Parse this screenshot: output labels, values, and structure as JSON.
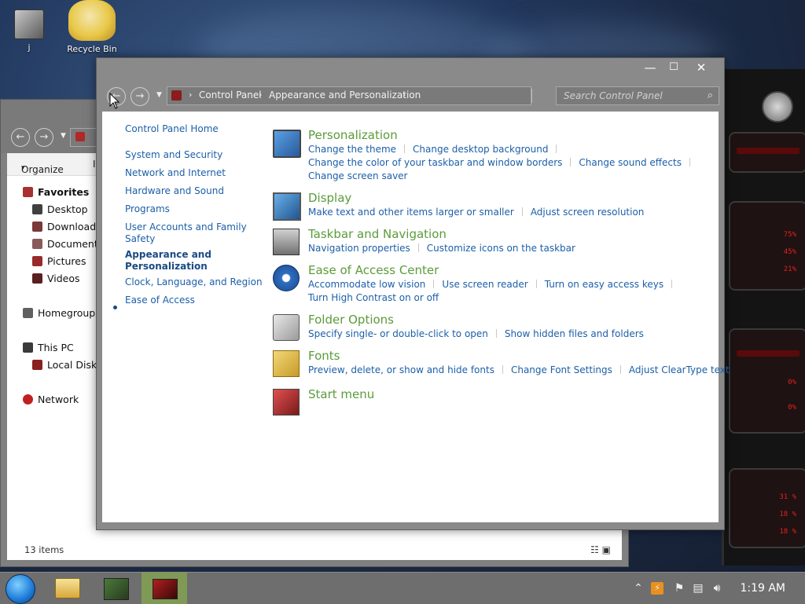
{
  "desktop": {
    "icons": [
      {
        "label": "j"
      },
      {
        "label": "Recycle Bin"
      }
    ]
  },
  "explorer": {
    "toolbar": {
      "organize": "Organize",
      "organize_caret": "▾",
      "cut_label": "I"
    },
    "tree": {
      "favorites": "Favorites",
      "desktop": "Desktop",
      "downloads": "Downloads",
      "documents": "Documents",
      "pictures": "Pictures",
      "videos": "Videos",
      "homegroup": "Homegroup",
      "this_pc": "This PC",
      "local_disk": "Local Disk",
      "network": "Network"
    },
    "status": "13 items"
  },
  "cp": {
    "window_controls": {
      "minimize": "—",
      "maximize": "☐",
      "close": "✕"
    },
    "breadcrumb": {
      "item1": "Control Panel",
      "item2": "Appearance and Personalization",
      "sep": "›"
    },
    "search_placeholder": "Search Control Panel",
    "left_nav": {
      "home": "Control Panel Home",
      "system": "System and Security",
      "network": "Network and Internet",
      "hardware": "Hardware and Sound",
      "programs": "Programs",
      "accounts_1": "User Accounts and Family",
      "accounts_2": "Safety",
      "appearance_1": "Appearance and",
      "appearance_2": "Personalization",
      "clock": "Clock, Language, and Region",
      "ease": "Ease of Access"
    },
    "categories": {
      "personalization": {
        "title": "Personalization",
        "links": [
          "Change the theme",
          "Change desktop background",
          "Change the color of your taskbar and window borders",
          "Change sound effects",
          "Change screen saver"
        ]
      },
      "display": {
        "title": "Display",
        "links": [
          "Make text and other items larger or smaller",
          "Adjust screen resolution"
        ]
      },
      "taskbar": {
        "title": "Taskbar and Navigation",
        "links": [
          "Navigation properties",
          "Customize icons on the taskbar"
        ]
      },
      "ease": {
        "title": "Ease of Access Center",
        "links": [
          "Accommodate low vision",
          "Use screen reader",
          "Turn on easy access keys",
          "Turn High Contrast on or off"
        ]
      },
      "folder": {
        "title": "Folder Options",
        "links": [
          "Specify single- or double-click to open",
          "Show hidden files and folders"
        ]
      },
      "fonts": {
        "title": "Fonts",
        "links": [
          "Preview, delete, or show and hide fonts",
          "Change Font Settings",
          "Adjust ClearType text"
        ]
      },
      "start": {
        "title": "Start menu"
      }
    }
  },
  "taskbar": {
    "clock": "1:19 AM"
  },
  "gadget": {
    "readouts": [
      "75%",
      "45%",
      "21%",
      "0%",
      "0%",
      "31 %",
      "18 %",
      "18 %"
    ]
  }
}
